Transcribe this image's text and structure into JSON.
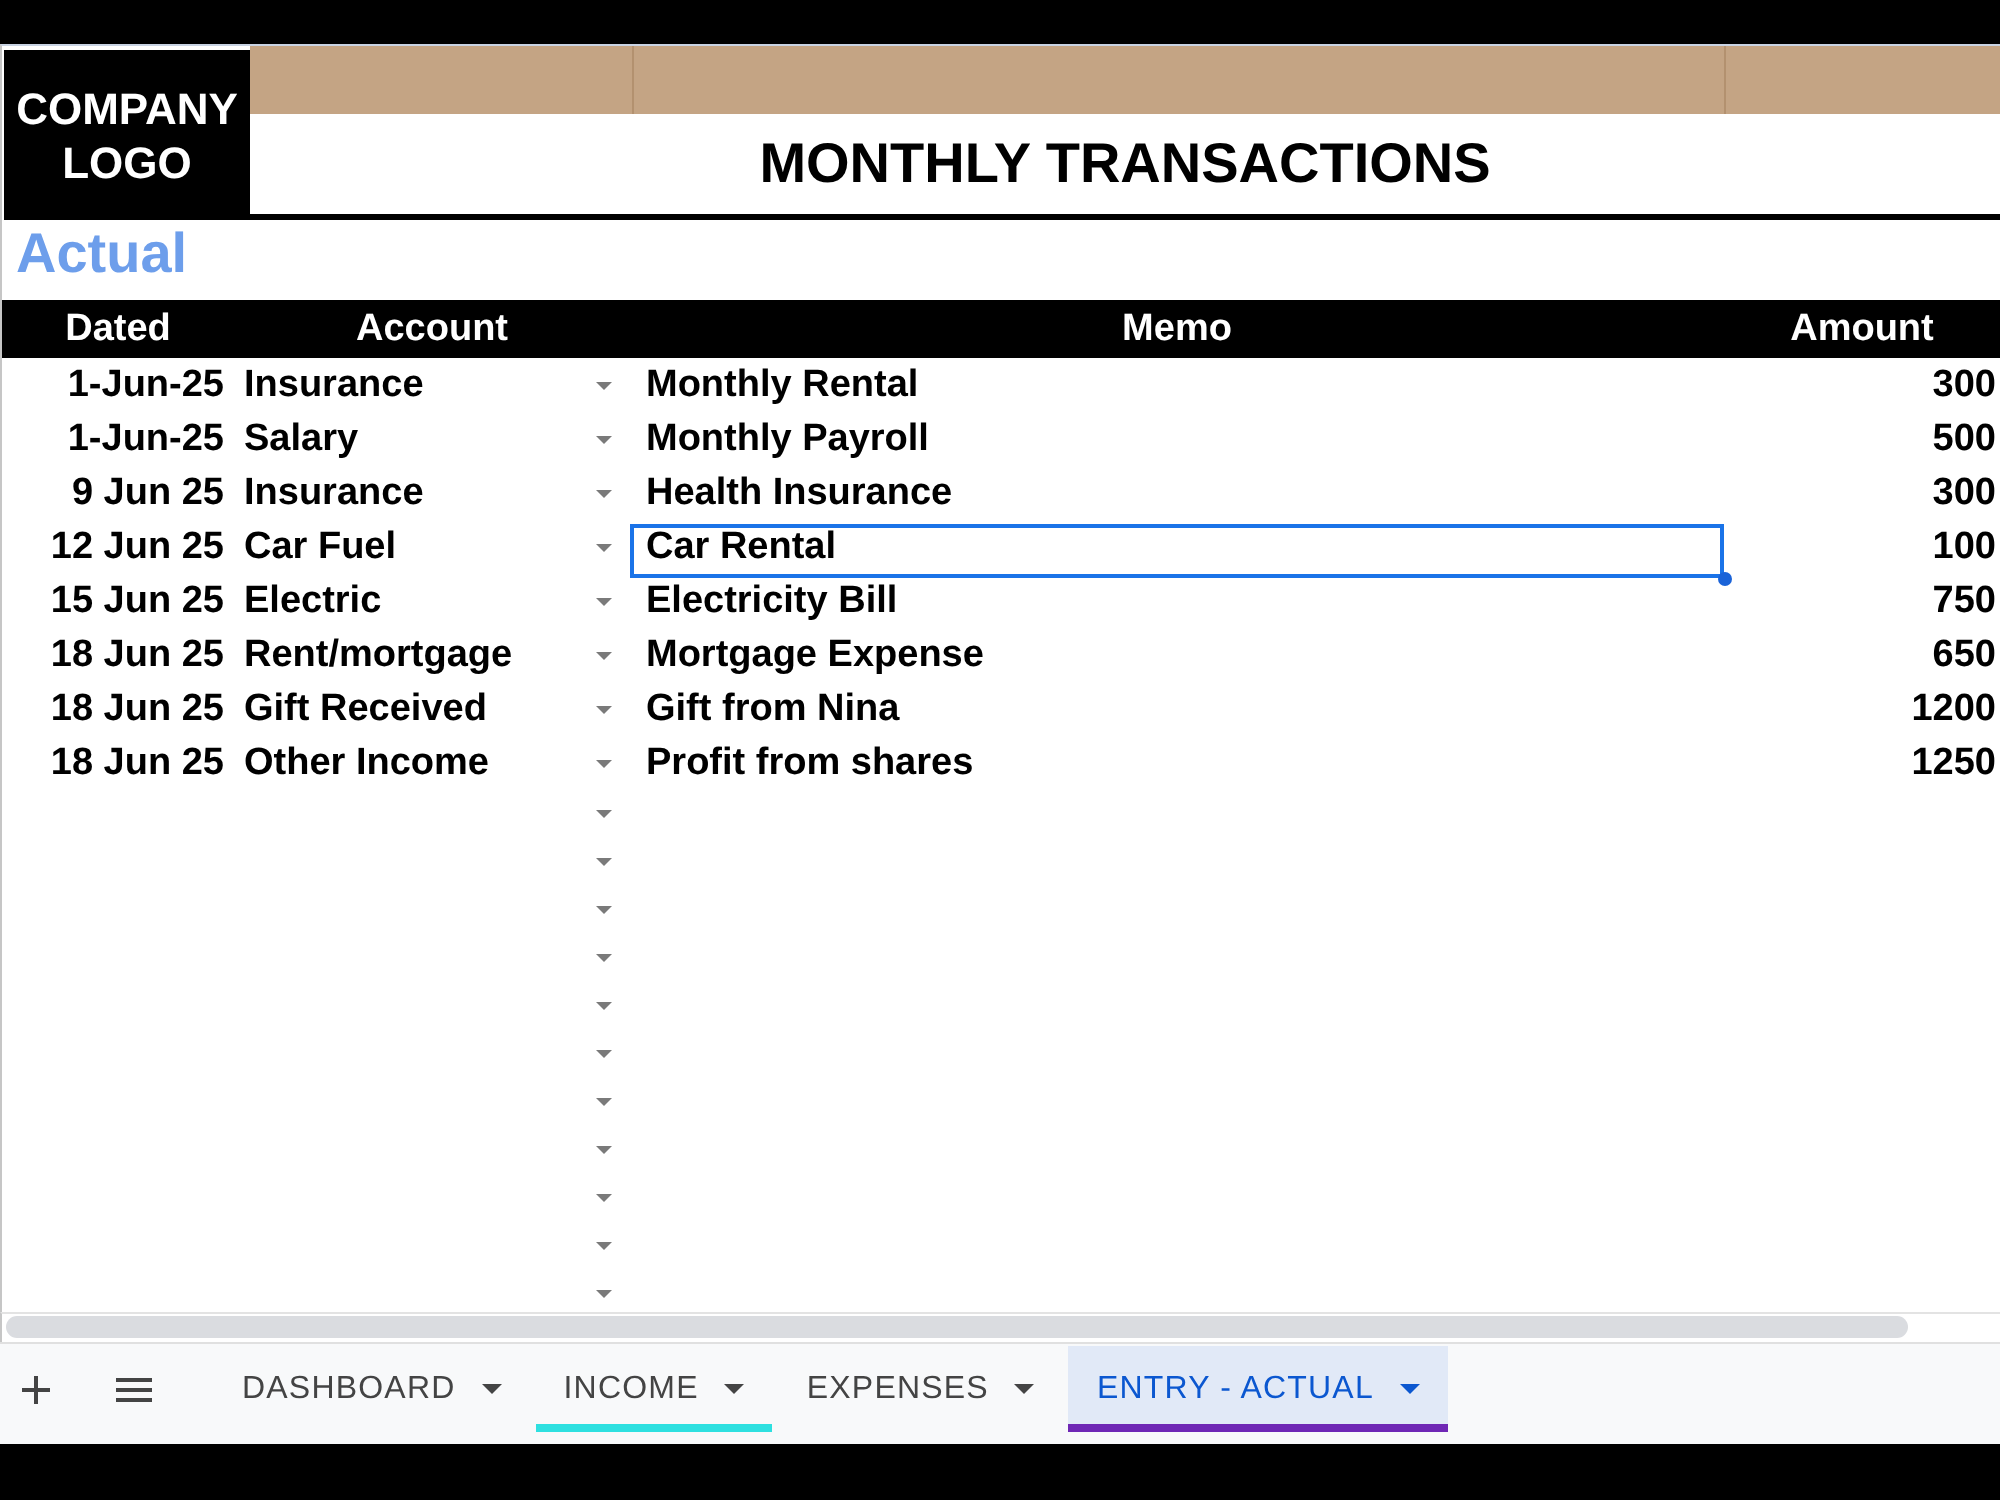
{
  "header": {
    "logo": "COMPANY LOGO",
    "title": "MONTHLY TRANSACTIONS"
  },
  "section_label": "Actual",
  "table": {
    "columns": [
      "Dated",
      "Account",
      "Memo",
      "Amount"
    ],
    "rows": [
      {
        "dated": "1-Jun-25",
        "account": "Insurance",
        "memo": "Monthly Rental",
        "amount": "300",
        "dropdown": true,
        "selected": false
      },
      {
        "dated": "1-Jun-25",
        "account": "Salary",
        "memo": "Monthly Payroll",
        "amount": "500",
        "dropdown": true,
        "selected": false
      },
      {
        "dated": "9 Jun 25",
        "account": "Insurance",
        "memo": "Health Insurance",
        "amount": "300",
        "dropdown": true,
        "selected": false
      },
      {
        "dated": "12 Jun 25",
        "account": "Car Fuel",
        "memo": "Car Rental",
        "amount": "100",
        "dropdown": true,
        "selected": true
      },
      {
        "dated": "15 Jun 25",
        "account": "Electric",
        "memo": "Electricity Bill",
        "amount": "750",
        "dropdown": true,
        "selected": false
      },
      {
        "dated": "18 Jun 25",
        "account": "Rent/mortgage",
        "memo": "Mortgage Expense",
        "amount": "650",
        "dropdown": true,
        "selected": false
      },
      {
        "dated": "18 Jun 25",
        "account": "Gift Received",
        "memo": "Gift from Nina",
        "amount": "1200",
        "dropdown": true,
        "selected": false
      },
      {
        "dated": "18 Jun 25",
        "account": "Other Income",
        "memo": "Profit from shares",
        "amount": "1250",
        "dropdown": true,
        "selected": false
      }
    ],
    "blank_rows": [
      {
        "dropdown": true
      },
      {
        "dropdown": true
      },
      {
        "dropdown": true
      },
      {
        "dropdown": true
      },
      {
        "dropdown": true
      },
      {
        "dropdown": true
      },
      {
        "dropdown": true
      },
      {
        "dropdown": true
      },
      {
        "dropdown": true
      },
      {
        "dropdown": true
      },
      {
        "dropdown": true
      }
    ]
  },
  "tabs": [
    {
      "label": "DASHBOARD",
      "selected": false
    },
    {
      "label": "INCOME",
      "selected": false,
      "color": "#2ee0e0"
    },
    {
      "label": "EXPENSES",
      "selected": false
    },
    {
      "label": "ENTRY - ACTUAL",
      "selected": true,
      "color": "#6f27b5"
    }
  ]
}
